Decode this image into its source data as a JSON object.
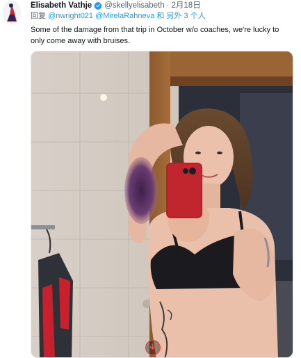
{
  "tweet": {
    "author": {
      "display_name": "Elisabeth Vathje",
      "handle": "@skellyelisabeth",
      "verified": true,
      "separator": "·",
      "date": "2月18日"
    },
    "reply": {
      "prefix": "回复",
      "mention_1": "@nwright021",
      "mention_2": "@MirelaRahneva",
      "connector": "和",
      "others": "另外 3 个人"
    },
    "text_line_1": "Some of the damage from that trip in October w/o coaches, we're lucky to",
    "text_line_2": "only come away with bruises.",
    "media": {
      "alt": "Mirror selfie in a bathroom showing a large purple bruise on the upper arm"
    }
  },
  "colors": {
    "link": "#1d9bf0",
    "secondary_text": "#536471",
    "primary_text": "#0f1419",
    "verified_badge": "#1d9bf0"
  },
  "icons": {
    "verified": "verified-badge-icon",
    "media_overlay": "video-record-icon"
  }
}
